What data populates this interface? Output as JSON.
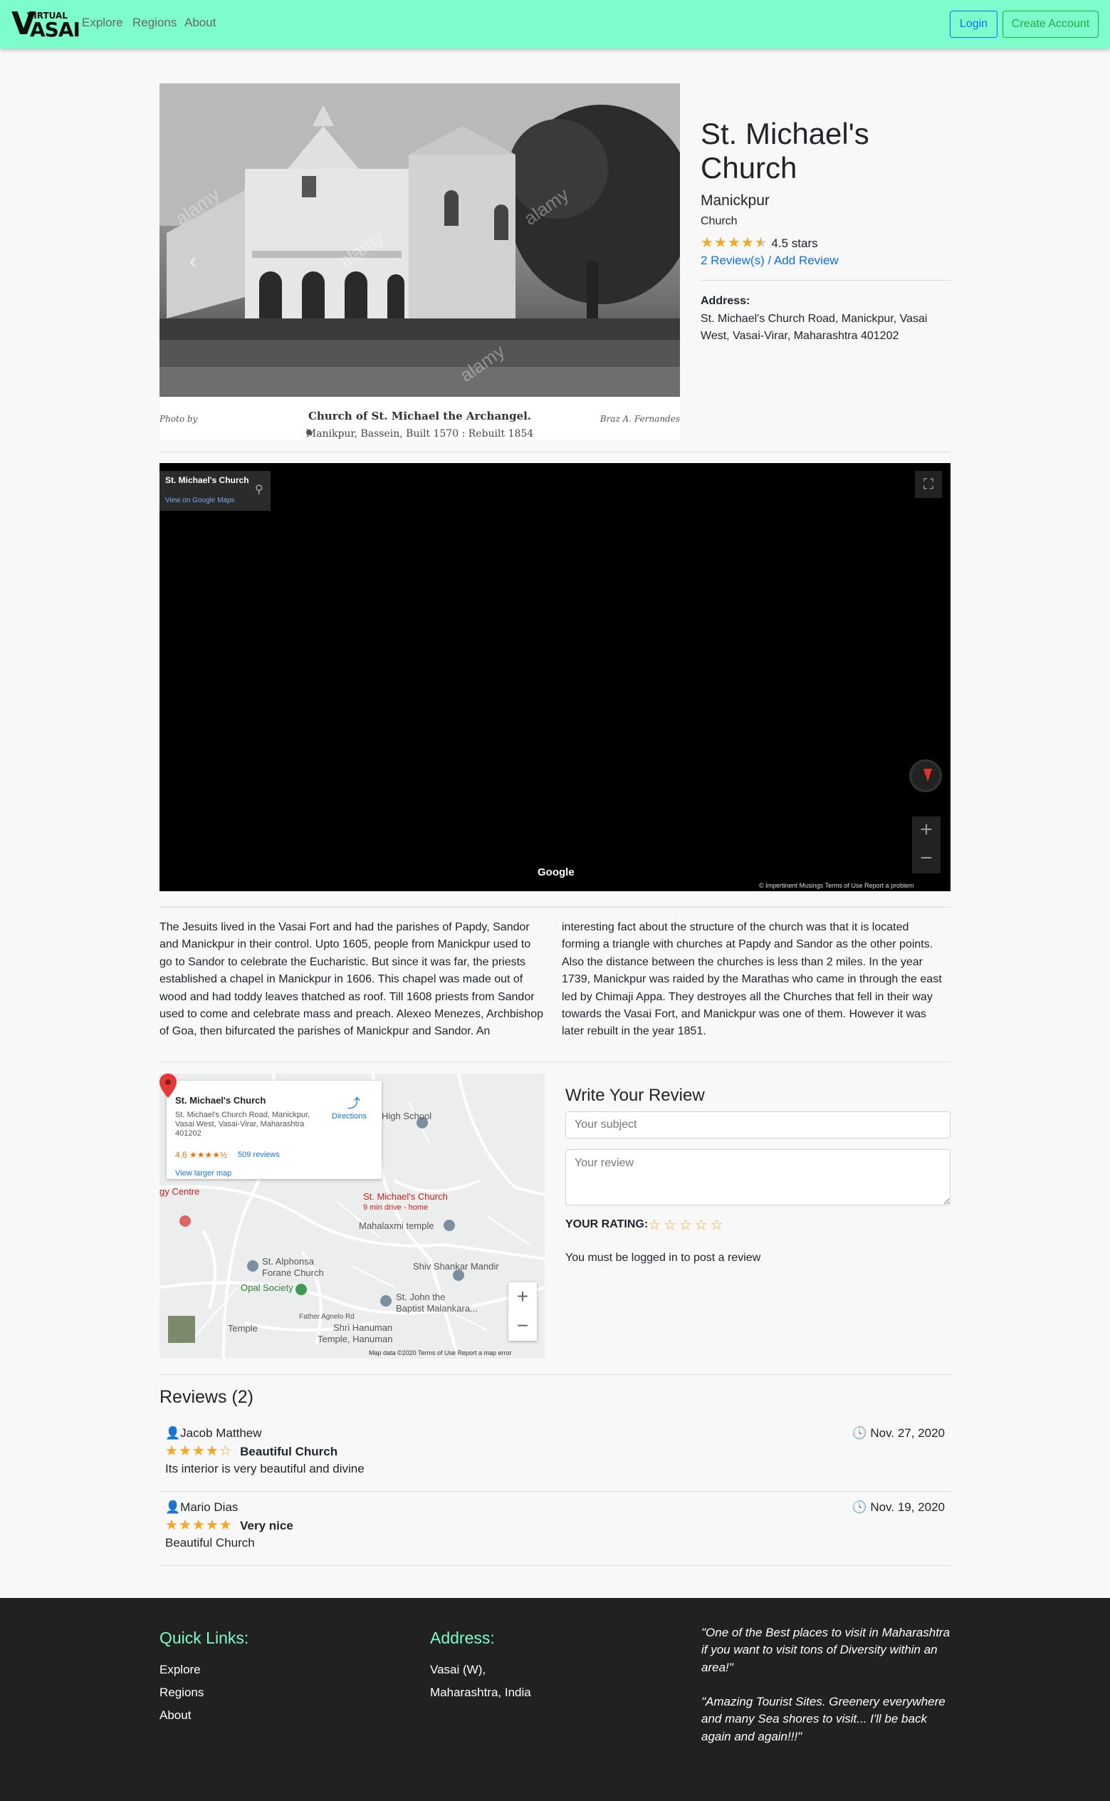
{
  "brand": {
    "virtual": "VIRTUAL",
    "v": "V",
    "asai": "ASAI"
  },
  "nav": {
    "explore": "Explore",
    "regions": "Regions",
    "about": "About",
    "login": "Login",
    "create_account": "Create Account"
  },
  "photo": {
    "credit_left": "Photo by",
    "credit_right": "Braz A. Fernandes",
    "caption": "Church of St. Michael the Archangel.",
    "subcaption": "Manikpur, Bassein, Built 1570 : Rebuilt 1854",
    "watermark": "alamy",
    "prev_glyph": "‹"
  },
  "place": {
    "title": "St. Michael's Church",
    "region": "Manickpur",
    "type": "Church",
    "rating_value": 4.5,
    "rating_text": "4.5 stars",
    "reviews_link": "2 Review(s) / Add Review",
    "address_label": "Address:",
    "address": "St. Michael's Church Road, Manickpur, Vasai West, Vasai-Virar, Maharashtra 401202"
  },
  "streetview": {
    "title": "St. Michael's Church",
    "link": "View on Google Maps",
    "google": "Google",
    "footer": "© Impertinent Musings     Terms of Use     Report a problem"
  },
  "description": {
    "col1": "The Jesuits lived in the Vasai Fort and had the parishes of Papdy, Sandor and Manickpur in their control. Upto 1605, people from Manickpur used to go to Sandor to celebrate the Eucharistic. But since it was far, the priests established a chapel in Manickpur in 1606. This chapel was made out of wood and had toddy leaves thatched as roof. Till 1608 priests from Sandor used to come and celebrate mass and preach. Alexeo Menezes, Archbishop of Goa, then bifurcated the parishes of Manickpur and Sandor. An",
    "col2": "interesting fact about the structure of the church was that it is located forming a triangle with churches at Papdy and Sandor as the other points. Also the distance between the churches is less than 2 miles. In the year 1739, Manickpur was raided by the Marathas who came in through the east led by Chimaji Appa. They destroyes all the Churches that fell in their way towards the Vasai Fort, and Manickpur was one of them. However it was later rebuilt in the year 1851."
  },
  "map": {
    "card_title": "St. Michael's Church",
    "card_address": "St. Michael's Church Road, Manickpur, Vasai West, Vasai-Virar, Maharashtra 401202",
    "card_rating": "4.6 ★★★★½",
    "card_reviews": "509 reviews",
    "card_larger": "View larger map",
    "card_directions": "Directions",
    "pin_label": "St. Michael's Church",
    "pin_sub": "9 min drive - home",
    "labels": {
      "high_school": "High School",
      "mahalaxmi": "Mahalaxmi temple",
      "alphonsa": "St. Alphonsa",
      "forane": "Forane Church",
      "opal": "Opal Society",
      "shiv": "Shiv Shankar Mandir",
      "john": "St. John the",
      "baptist": "Baptist Malankara...",
      "father": "Father Agnelo Rd",
      "hanuman": "Shri Hanuman",
      "hanuman2": "Temple, Hanuman",
      "centre": "gy Centre",
      "temple": "Temple"
    },
    "zoom_in": "+",
    "zoom_out": "−",
    "footer": "Map data ©2020     Terms of Use     Report a map error"
  },
  "review_form": {
    "title": "Write Your Review",
    "subject_placeholder": "Your subject",
    "review_placeholder": "Your review",
    "rating_label": "YOUR RATING:",
    "login_msg": "You must be logged in to post a review"
  },
  "reviews": {
    "heading": "Reviews (2)",
    "items": [
      {
        "user": "Jacob Matthew",
        "date": "Nov. 27, 2020",
        "rating": 4,
        "title": "Beautiful Church",
        "body": "Its interior is very beautiful and divine"
      },
      {
        "user": "Mario Dias",
        "date": "Nov. 19, 2020",
        "rating": 5,
        "title": "Very nice",
        "body": "Beautiful Church"
      }
    ]
  },
  "footer": {
    "quick_links": "Quick Links:",
    "links": [
      "Explore",
      "Regions",
      "About"
    ],
    "address_heading": "Address:",
    "address_lines": [
      "Vasai (W),",
      "Maharashtra, India"
    ],
    "quote1": "\"One of the Best places to visit in Maharashtra if you want to visit tons of Diversity within an area!\"",
    "quote2": "\"Amazing Tourist Sites. Greenery everywhere and many Sea shores to visit... I'll be back again and again!!!\""
  },
  "colors": {
    "navbar": "#7dfdcc",
    "star": "#f5a623",
    "link": "#0d6efd",
    "footer": "#212121",
    "footer_heading": "#7dfdcc"
  }
}
